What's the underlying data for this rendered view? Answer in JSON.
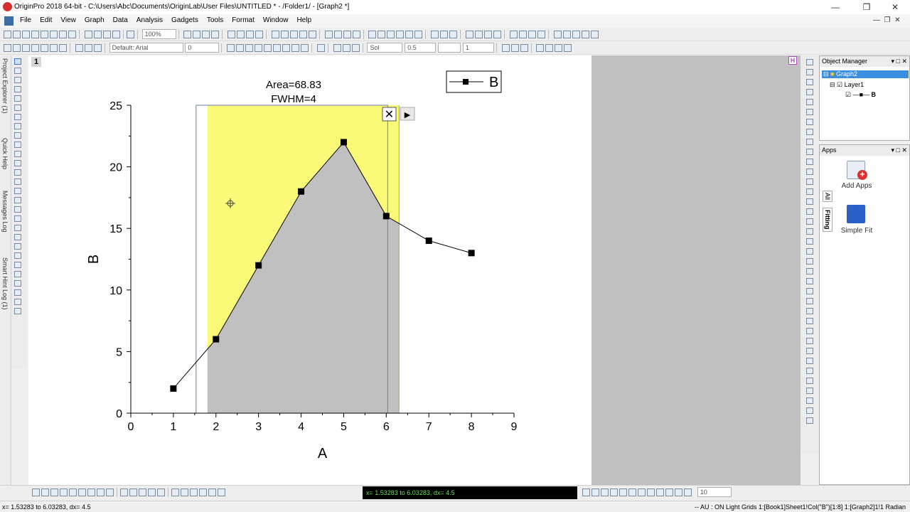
{
  "window": {
    "title": "OriginPro 2018 64-bit - C:\\Users\\Abc\\Documents\\OriginLab\\User Files\\UNTITLED * - /Folder1/ - [Graph2 *]"
  },
  "menu": [
    "File",
    "Edit",
    "View",
    "Graph",
    "Data",
    "Analysis",
    "Gadgets",
    "Tools",
    "Format",
    "Window",
    "Help"
  ],
  "toolbar": {
    "zoom": "100%",
    "font": "Default: Arial",
    "font_size": "0",
    "line_style": "Sol",
    "line_width": "0.5",
    "symbol_size": "1"
  },
  "left_tabs": [
    "Project Explorer (1)",
    "Quick Help",
    "Messages Log",
    "Smart Hint Log (1)"
  ],
  "layer_badge": "1",
  "hide_badge": "H",
  "graph": {
    "annotation_area": "Area=68.83",
    "annotation_fwhm": "FWHM=4",
    "legend_label": "B",
    "roi_close_glyph": "✕",
    "roi_menu_glyph": "▶"
  },
  "chart_data": {
    "type": "line",
    "xlabel": "A",
    "ylabel": "B",
    "xlim": [
      0,
      9
    ],
    "ylim": [
      0,
      25
    ],
    "x_ticks": [
      "0",
      "1",
      "2",
      "3",
      "4",
      "5",
      "6",
      "7",
      "8",
      "9"
    ],
    "y_ticks": [
      "0",
      "5",
      "10",
      "15",
      "20",
      "25"
    ],
    "grid": false,
    "legend": "top-right",
    "series": [
      {
        "name": "B",
        "x": [
          1,
          2,
          3,
          4,
          5,
          6,
          7,
          8
        ],
        "y": [
          2,
          6,
          12,
          18,
          22,
          16,
          14,
          13
        ],
        "color": "#000000",
        "marker": "square"
      }
    ],
    "roi": {
      "x_from": 1.53283,
      "x_to": 6.03283,
      "integration_from": 1.8,
      "integration_to": 6.3
    },
    "roi_fill_color": "#fafa78",
    "area_fill_color": "#c0c0c0"
  },
  "object_manager": {
    "title": "Object Manager",
    "graph": "Graph2",
    "layer": "Layer1",
    "plot": "B"
  },
  "apps": {
    "title": "Apps",
    "tabs": [
      "All",
      "Fitting"
    ],
    "items": [
      "Add Apps",
      "Simple Fit"
    ]
  },
  "status": {
    "message": "x= 1.53283 to 6.03283, dx= 4.5",
    "left": "x= 1.53283 to 6.03283, dx= 4.5",
    "right": "--   AU : ON  Light Grids  1:[Book1]Sheet1!Col(\"B\")[1:8]  1:[Graph2]1!1  Radian",
    "bottom_combo": "10"
  }
}
